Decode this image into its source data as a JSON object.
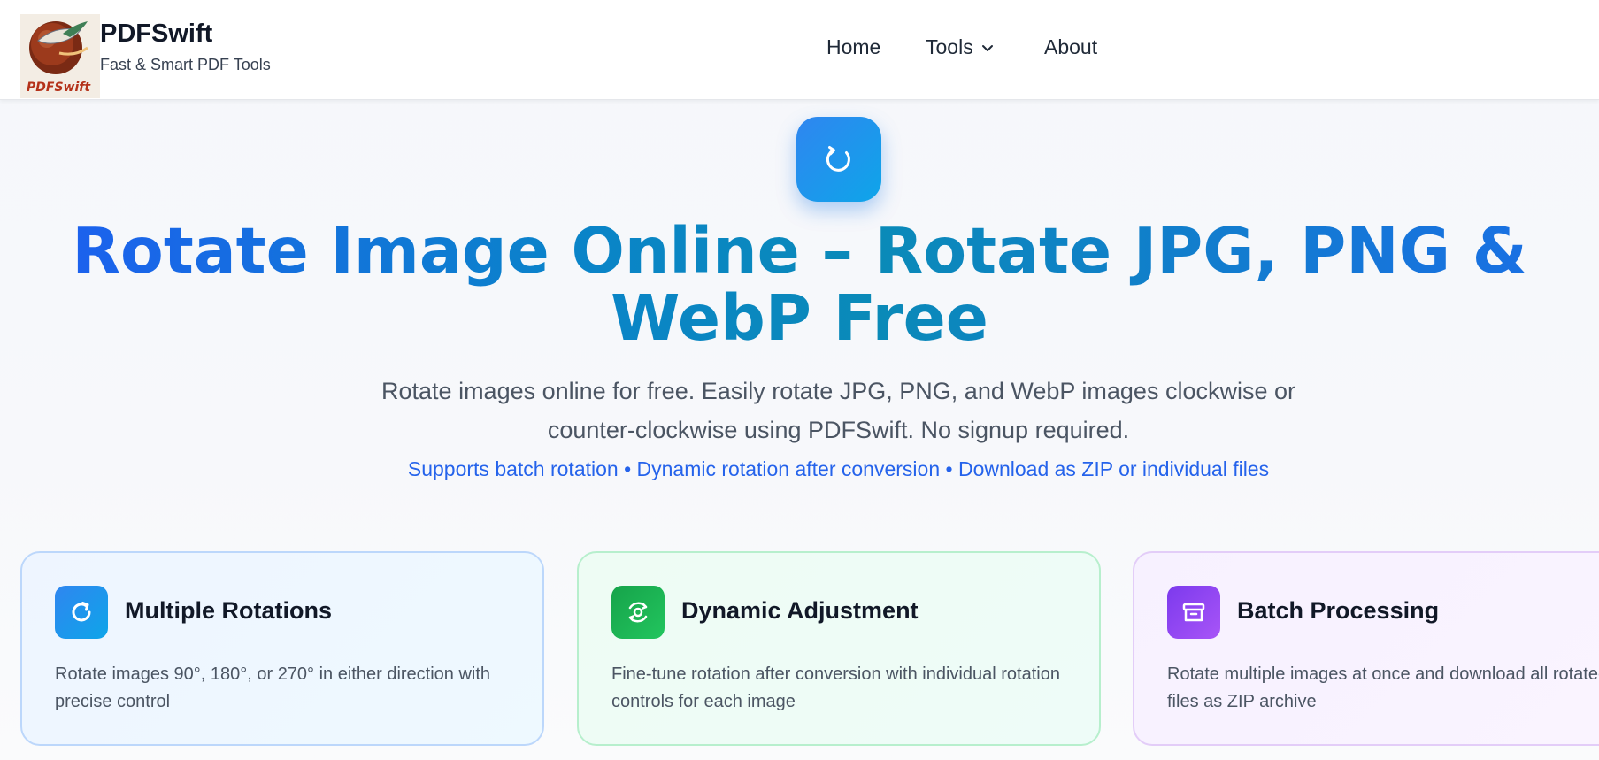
{
  "header": {
    "logo_text": "PDFSwift",
    "brand_name": "PDFSwift",
    "tagline": "Fast & Smart PDF Tools",
    "nav": {
      "home": "Home",
      "tools": "Tools",
      "about": "About"
    }
  },
  "hero": {
    "icon": "rotate-icon",
    "title": "Rotate Image Online – Rotate JPG, PNG & WebP Free",
    "subtitle": "Rotate images online for free. Easily rotate JPG, PNG, and WebP images clockwise or counter-clockwise using PDFSwift. No signup required.",
    "features": "Supports batch rotation • Dynamic rotation after conversion • Download as ZIP or individual files"
  },
  "cards": [
    {
      "icon": "rotate-cw-icon",
      "title": "Multiple Rotations",
      "description": "Rotate images 90°, 180°, or 270° in either direction with precise control"
    },
    {
      "icon": "orbit-icon",
      "title": "Dynamic Adjustment",
      "description": "Fine-tune rotation after conversion with individual rotation controls for each image"
    },
    {
      "icon": "archive-icon",
      "title": "Batch Processing",
      "description": "Rotate multiple images at once and download all rotated files as ZIP archive"
    }
  ],
  "colors": {
    "primary_blue": "#2f86f0",
    "title_gradient_start": "#1d5ff0",
    "title_gradient_mid": "#0a8ab8",
    "feature_link": "#2563eb",
    "green_accent": "#16a34a",
    "purple_accent": "#7c3aed"
  }
}
